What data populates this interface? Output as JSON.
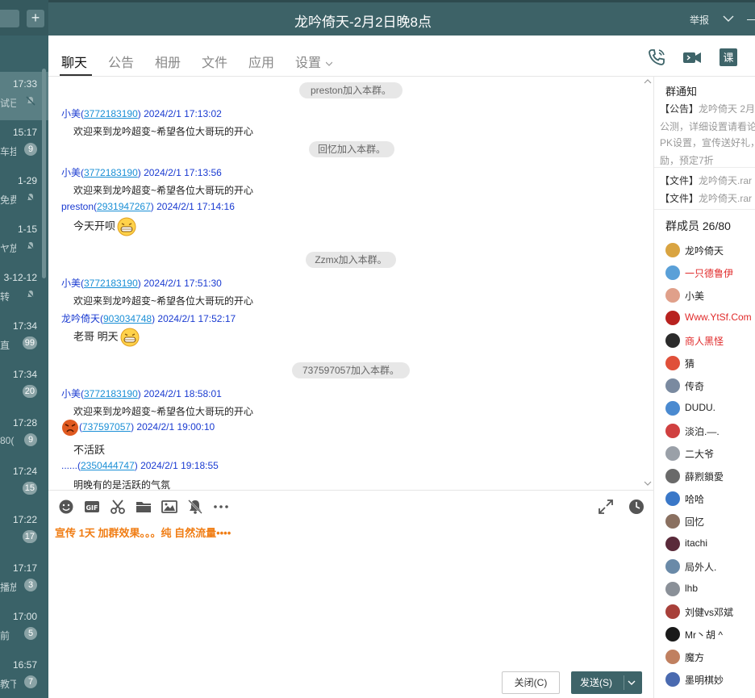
{
  "window": {
    "title": "龙吟倚天-2月2日晚8点",
    "report_label": "举报"
  },
  "left_list": {
    "items": [
      {
        "time": "17:33",
        "snippet": "试已",
        "badge": "",
        "muted": true,
        "active": true
      },
      {
        "time": "15:17",
        "snippet": "车挂",
        "badge": "9",
        "muted": false
      },
      {
        "time": "1-29",
        "snippet": "免费",
        "badge": "",
        "muted": true
      },
      {
        "time": "1-15",
        "snippet": "ヤ放",
        "badge": "",
        "muted": true
      },
      {
        "time": "3-12-12",
        "snippet": "转",
        "badge": "",
        "muted": true
      },
      {
        "time": "17:34",
        "snippet": "直",
        "badge": "99",
        "muted": false
      },
      {
        "time": "17:34",
        "snippet": "",
        "badge": "20",
        "muted": false
      },
      {
        "time": "17:28",
        "snippet": "80(",
        "badge": "9",
        "muted": false
      },
      {
        "time": "17:24",
        "snippet": "",
        "badge": "15",
        "muted": false
      },
      {
        "time": "17:22",
        "snippet": "",
        "badge": "17",
        "muted": false
      },
      {
        "time": "17:17",
        "snippet": "播放",
        "badge": "3",
        "muted": false
      },
      {
        "time": "17:00",
        "snippet": "前",
        "badge": "5",
        "muted": false
      },
      {
        "time": "16:57",
        "snippet": "教下",
        "badge": "7",
        "muted": false
      }
    ]
  },
  "tabs": [
    {
      "label": "聊天",
      "active": true
    },
    {
      "label": "公告"
    },
    {
      "label": "相册"
    },
    {
      "label": "文件"
    },
    {
      "label": "应用"
    },
    {
      "label": "设置"
    }
  ],
  "toolbar_icons": [
    "phone-icon",
    "video-icon",
    "class-icon"
  ],
  "messages": {
    "sys1": "preston加入本群。",
    "m1_name": "小美(",
    "m1_qq": "3772183190",
    "m1_time": ") 2024/2/1 17:13:02",
    "m1_text": "欢迎来到龙吟超变~希望各位大哥玩的开心",
    "sys2": "回忆加入本群。",
    "m2_name": "小美(",
    "m2_qq": "3772183190",
    "m2_time": ") 2024/2/1 17:13:56",
    "m2_text": "欢迎来到龙吟超变~希望各位大哥玩的开心",
    "m3_name": "preston(",
    "m3_qq": "2931947267",
    "m3_time": ") 2024/2/1 17:14:16",
    "m3_text": "今天开呗",
    "sys3": "Zzmx加入本群。",
    "m4_name": "小美(",
    "m4_qq": "3772183190",
    "m4_time": ") 2024/2/1 17:51:30",
    "m4_text": "欢迎来到龙吟超变~希望各位大哥玩的开心",
    "m5_name": "龙吟倚天(",
    "m5_qq": "903034748",
    "m5_time": ") 2024/2/1 17:52:17",
    "m5_text": "老哥 明天",
    "sys4": "737597057加入本群。",
    "m6_name": "小美(",
    "m6_qq": "3772183190",
    "m6_time": ") 2024/2/1 18:58:01",
    "m6_text": "欢迎来到龙吟超变~希望各位大哥玩的开心",
    "m7_name": "(",
    "m7_qq": "737597057",
    "m7_time": ") 2024/2/1 19:00:10",
    "m7_text": "不活跃",
    "m8_name": "......(",
    "m8_qq": "2350444747",
    "m8_time": ") 2024/2/1 19:18:55",
    "m8_text": "明晚有的是活跃的气氛"
  },
  "composer": {
    "draft_text": "宣传 1天 加群效果。。。纯 自然流量••••",
    "close_label": "关闭(C)",
    "send_label": "发送(S)"
  },
  "right_panel": {
    "notice_title": "群通知",
    "notice_line1_key": "【公告】",
    "notice_line1": "龙吟倚天 2月",
    "notice_line2": "公测，详细设置请看论",
    "notice_line3": "PK设置，宣传送好礼，",
    "notice_line4": "励，预定7折",
    "file1_key": "【文件】",
    "file1": "龙吟倚天.rar",
    "file2_key": "【文件】",
    "file2": "龙吟倚天.rar",
    "members_title": "群成员 26/80",
    "members": [
      {
        "name": "龙吟倚天",
        "red": false,
        "color": "#d9a441"
      },
      {
        "name": "一只德鲁伊",
        "red": true,
        "color": "#5aa0d8"
      },
      {
        "name": "小美",
        "red": false,
        "color": "#e0a08a"
      },
      {
        "name": "Www.YtSf.Com",
        "red": true,
        "color": "#b8221f"
      },
      {
        "name": "商人黑怪",
        "red": true,
        "color": "#2b2b2b"
      },
      {
        "name": "猜",
        "red": false,
        "color": "#e0503a"
      },
      {
        "name": "传奇",
        "red": false,
        "color": "#7a8aa0"
      },
      {
        "name": "DUDU.",
        "red": false,
        "color": "#4a8ad0"
      },
      {
        "name": "淡泊.—.",
        "red": false,
        "color": "#d04040"
      },
      {
        "name": "二大爷",
        "red": false,
        "color": "#9aa0a8"
      },
      {
        "name": "薛煭鎖愛",
        "red": false,
        "color": "#6a6a6a"
      },
      {
        "name": "哈哈",
        "red": false,
        "color": "#3a78c8"
      },
      {
        "name": "回忆",
        "red": false,
        "color": "#8a7060"
      },
      {
        "name": "itachi",
        "red": false,
        "color": "#5a2a3a"
      },
      {
        "name": "局外人.",
        "red": false,
        "color": "#6a8aa8"
      },
      {
        "name": "lhb",
        "red": false,
        "color": "#8a9098"
      },
      {
        "name": "刘健vs邓斌",
        "red": false,
        "color": "#a8403a"
      },
      {
        "name": "Mr丶胡 ^",
        "red": false,
        "color": "#1a1a1a"
      },
      {
        "name": "魔方",
        "red": false,
        "color": "#c08060"
      },
      {
        "name": "墨明棋妙",
        "red": false,
        "color": "#4a6ab0"
      }
    ]
  }
}
